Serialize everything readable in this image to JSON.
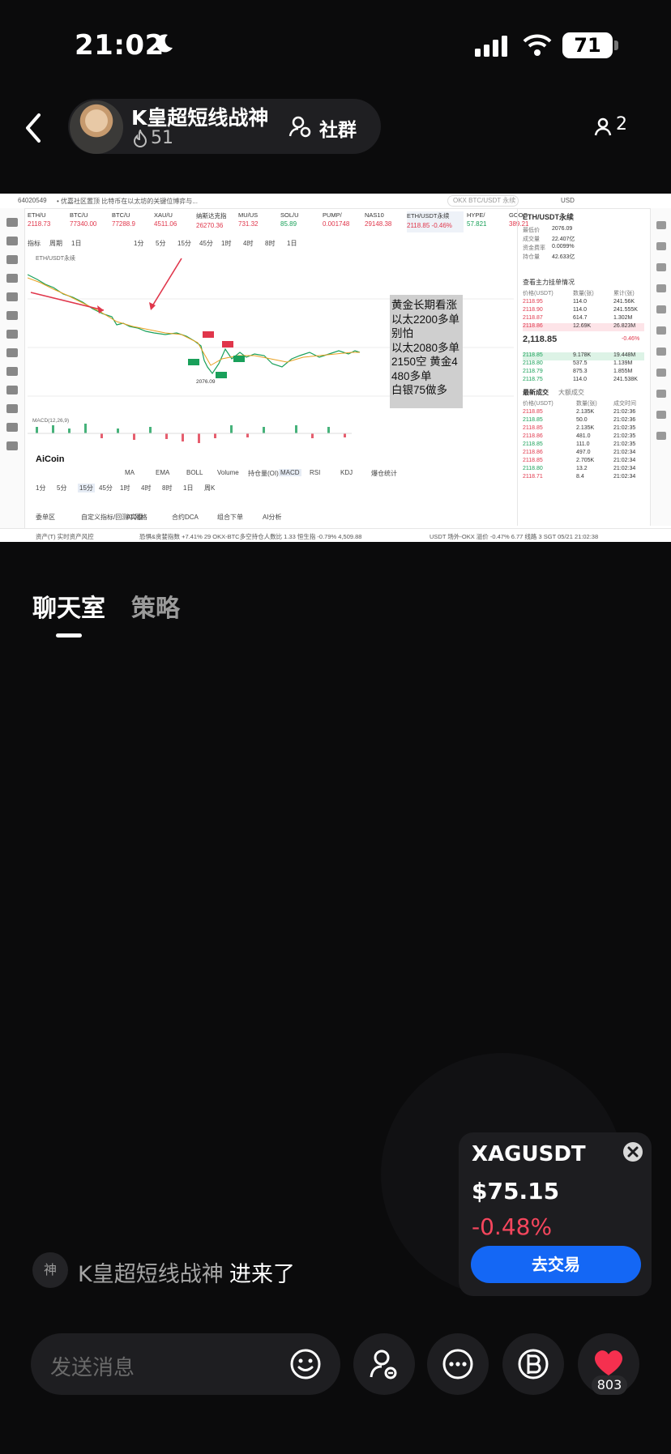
{
  "status_bar": {
    "time": "21:02",
    "battery": "71"
  },
  "header": {
    "host_name": "K皇超短线战神",
    "fire_count": "51",
    "community_label": "社群",
    "viewer_count": "2"
  },
  "screen": {
    "top_bar": {
      "uid": "64020549",
      "notice": "• 优嘉社区置顶  比特币在以太坊的关键位博弈与...",
      "search_placeholder": "OKX BTC/USDT 永续",
      "currency": "USD"
    },
    "tabs": [
      {
        "name": "ETH/U",
        "value": "2118.73"
      },
      {
        "name": "BTC/U",
        "value": "77340.00"
      },
      {
        "name": "BTC/U",
        "value": "77288.9"
      },
      {
        "name": "XAU/U",
        "value": "4511.06"
      },
      {
        "name": "纳斯达克指",
        "value": "26270.36"
      },
      {
        "name": "MU/US",
        "value": "731.32"
      },
      {
        "name": "SOL/U",
        "value": "85.89"
      },
      {
        "name": "PUMP/",
        "value": "0.001748"
      },
      {
        "name": "NAS10",
        "value": "29148.38"
      },
      {
        "name": "ETH/USDT永续",
        "value": "2118.85 -0.46%"
      },
      {
        "name": "HYPE/",
        "value": "57.821"
      },
      {
        "name": "GOOG",
        "value": "389.21"
      }
    ],
    "toolbar": [
      "指标",
      "周期",
      "1日",
      "1分",
      "5分",
      "15分",
      "45分",
      "1时",
      "4时",
      "8时",
      "1日"
    ],
    "chart_labels": {
      "pair": "ETH/USDT永续",
      "macd": "MACD(12,26,9)",
      "low": "2076.09",
      "aicoin": "AiCoin"
    },
    "annotation_lines": [
      "黄金长期看涨",
      "以太2200多单",
      "别怕",
      "以太2080多单",
      "2150空 黄金4",
      "480多单",
      "白银75做多"
    ],
    "bottom_periods": [
      "1分",
      "5分",
      "15分",
      "45分",
      "1时",
      "4时",
      "8时",
      "1日",
      "周K"
    ],
    "bottom_indicators": [
      "MA",
      "EMA",
      "BOLL",
      "Volume",
      "持仓量(OI)",
      "MACD",
      "RSI",
      "KDJ",
      "爆仓统计"
    ],
    "bottom_tools": [
      "委单区",
      "自定义指标/回测/实盘",
      "AI 网格",
      "合约DCA",
      "组合下单",
      "AI分析"
    ],
    "right_panel": {
      "title": "ETH/USDT永续",
      "stats": [
        [
          "最低价",
          "2076.09"
        ],
        [
          "成交量",
          "22.407亿"
        ],
        [
          "资金费率",
          "0.0099%"
        ],
        [
          "持仓量",
          "42.633亿"
        ]
      ],
      "section": "查看主力挂单情况",
      "header": [
        "价格(USDT)",
        "数量(张)",
        "累计(张)"
      ],
      "asks": [
        [
          "2118.95",
          "114.0",
          "241.56K"
        ],
        [
          "2118.90",
          "114.0",
          "241.555K"
        ],
        [
          "2118.87",
          "614.7",
          "1.302M"
        ],
        [
          "2118.86",
          "12.69K",
          "26.823M"
        ]
      ],
      "mid": "2,118.85",
      "mid_change": "-0.46%",
      "bids": [
        [
          "2118.85",
          "9.178K",
          "19.448M"
        ],
        [
          "2118.80",
          "537.5",
          "1.139M"
        ],
        [
          "2118.79",
          "875.3",
          "1.855M"
        ],
        [
          "2118.75",
          "114.0",
          "241.538K"
        ]
      ],
      "trades_tab": [
        "最新成交",
        "大额成交"
      ],
      "trades_header": [
        "价格(USDT)",
        "数量(张)",
        "成交时间"
      ],
      "trades": [
        [
          "2118.85",
          "2.135K",
          "21:02:36"
        ],
        [
          "2118.85",
          "50.0",
          "21:02:36"
        ],
        [
          "2118.85",
          "2.135K",
          "21:02:35"
        ],
        [
          "2118.86",
          "481.0",
          "21:02:35"
        ],
        [
          "2118.85",
          "111.0",
          "21:02:35"
        ],
        [
          "2118.86",
          "497.0",
          "21:02:34"
        ],
        [
          "2118.85",
          "2.705K",
          "21:02:34"
        ],
        [
          "2118.80",
          "13.2",
          "21:02:34"
        ],
        [
          "2118.71",
          "8.4",
          "21:02:34"
        ]
      ]
    },
    "status_line": {
      "left": "资产(T)   实时资产风控",
      "mid": "恐惧&贪婪指数 +7.41% 29   OKX-BTC多空持仓人数比 1.33   恒生指 -0.79% 4,509.88",
      "right": "USDT 场外-OKX   溢价 -0.47%   6.77        线路 3  SGT 05/21 21:02:38"
    }
  },
  "tabs": {
    "chat": "聊天室",
    "strategy": "策略"
  },
  "chat": {
    "badge": "神",
    "join_user": "K皇超短线战神",
    "join_text": "进来了"
  },
  "ticker": {
    "symbol": "XAGUSDT",
    "price": "$75.15",
    "change": "-0.48%",
    "button": "去交易"
  },
  "composer": {
    "placeholder": "发送消息",
    "like_count": "803"
  },
  "colors": {
    "accent": "#1467f5",
    "negative": "#f6465d",
    "background": "#0b0b0c"
  }
}
